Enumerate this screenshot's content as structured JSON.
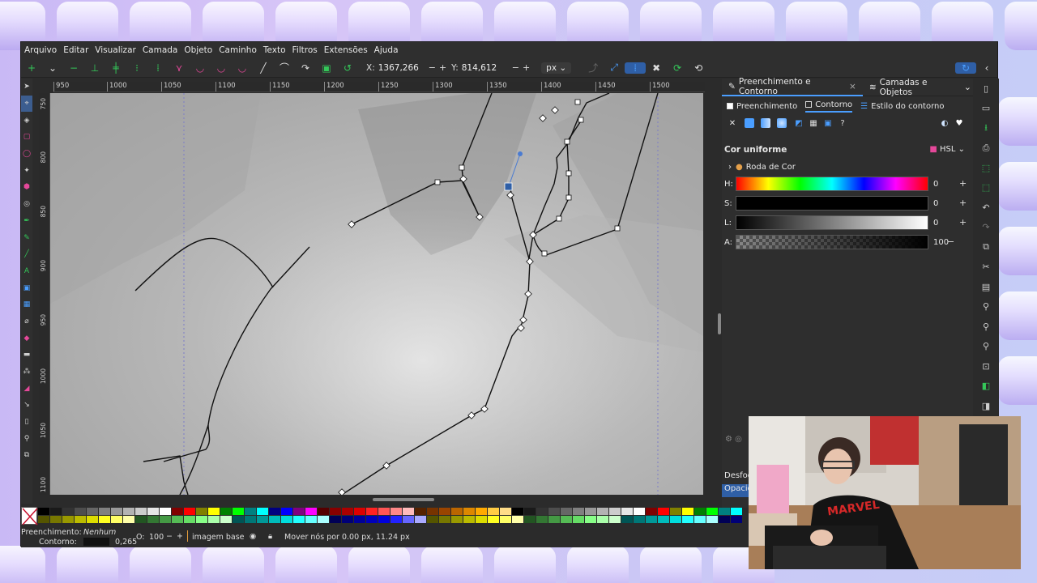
{
  "menu": [
    "Arquivo",
    "Editar",
    "Visualizar",
    "Camada",
    "Objeto",
    "Caminho",
    "Texto",
    "Filtros",
    "Extensões",
    "Ajuda"
  ],
  "toolctrl": {
    "x_label": "X:",
    "x_value": "1367,266",
    "y_label": "Y:",
    "y_value": "814,612",
    "unit": "px"
  },
  "ruler_top": [
    "950",
    "1000",
    "1050",
    "1100",
    "1150",
    "1200",
    "1250",
    "1300",
    "1350",
    "1400",
    "1450",
    "1500"
  ],
  "ruler_left": [
    "750",
    "800",
    "850",
    "900",
    "950",
    "1000",
    "1050",
    "1100"
  ],
  "panel": {
    "tab1": "Preenchimento e Contorno",
    "tab2": "Camadas e Objetos",
    "subtab_fill": "Preenchimento",
    "subtab_stroke": "Contorno",
    "subtab_style": "Estilo do contorno",
    "help": "?",
    "section": "Cor uniforme",
    "mode": "HSL",
    "wheel": "Roda de Cor",
    "h_label": "H:",
    "h_value": "0",
    "s_label": "S:",
    "s_value": "0",
    "l_label": "L:",
    "l_value": "0",
    "a_label": "A:",
    "a_value": "100"
  },
  "bottom_tabs": [
    "Desfoq",
    "Opacid"
  ],
  "status": {
    "fill_label": "Preenchimento:",
    "fill_value": "Nenhum",
    "stroke_label": "Contorno:",
    "stroke_width": "0,265",
    "opacity_label": "O:",
    "opacity_value": "100",
    "layer": "imagem base",
    "message": "Mover nós por 0.00 px, 11.24 px"
  },
  "colors": {
    "accent": "#4a9eff",
    "toolbar_green": "#34c759",
    "toolbar_pink": "#e5489a"
  },
  "webcam_shirt_text": "MARVEL"
}
